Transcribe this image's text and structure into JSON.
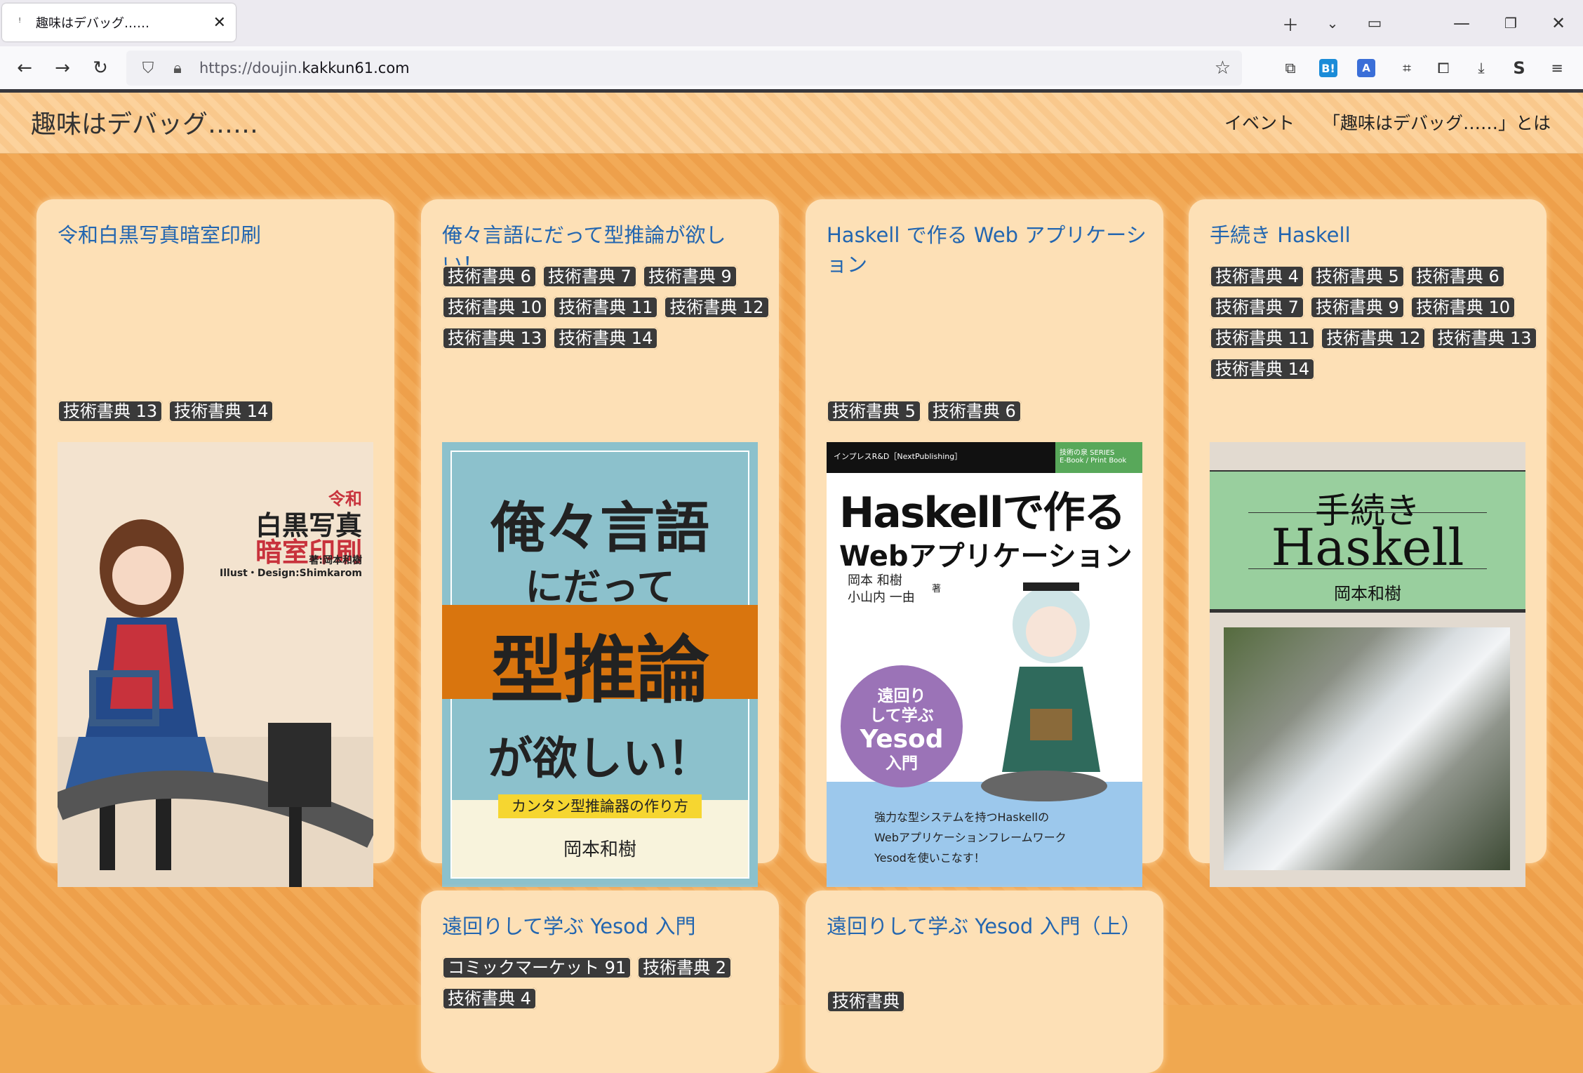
{
  "browser": {
    "tab_title": "趣味はデバッグ……",
    "url_prefix": "https://doujin.",
    "url_domain": "kakkun61.com"
  },
  "site": {
    "title": "趣味はデバッグ……",
    "nav": [
      "イベント",
      "「趣味はデバッグ……」とは"
    ]
  },
  "cards": [
    {
      "title": "令和白黒写真暗室印刷",
      "tags": [
        "技術書典 13",
        "技術書典 14"
      ],
      "cover": {
        "title_line1": "令和",
        "title_line2": "白黒写真",
        "title_line3": "暗室印刷",
        "credit1": "著:岡本和樹",
        "credit2": "Illust・Design:Shimkarom"
      }
    },
    {
      "title": "俺々言語にだって型推論が欲しい！",
      "tags": [
        "技術書典 6",
        "技術書典 7",
        "技術書典 9",
        "技術書典 10",
        "技術書典 11",
        "技術書典 12",
        "技術書典 13",
        "技術書典 14"
      ],
      "cover": {
        "line1": "俺々言語",
        "line2": "にだって",
        "line3": "型推論",
        "line4": "が欲しい！",
        "subtitle": "カンタン型推論器の作り方",
        "author": "岡本和樹"
      }
    },
    {
      "title": "Haskell で作る Web アプリケーション",
      "tags": [
        "技術書典 5",
        "技術書典 6"
      ],
      "cover": {
        "publisher": "インプレスR&D［NextPublishing］",
        "series": "技術の泉 SERIES",
        "format": "E-Book / Print Book",
        "title1": "Haskellで作る",
        "title2": "Webアプリケーション",
        "author1": "岡本 和樹",
        "author2": "小山内 一由",
        "author_suffix": "著",
        "badge1": "遠回り",
        "badge2": "して学ぶ",
        "badge3": "Yesod",
        "badge4": "入門",
        "desc1": "強力な型システムを持つHaskellの",
        "desc2": "Webアプリケーションフレームワーク",
        "desc3": "Yesodを使いこなす！"
      }
    },
    {
      "title": "手続き Haskell",
      "tags": [
        "技術書典 4",
        "技術書典 5",
        "技術書典 6",
        "技術書典 7",
        "技術書典 9",
        "技術書典 10",
        "技術書典 11",
        "技術書典 12",
        "技術書典 13",
        "技術書典 14"
      ],
      "cover": {
        "title1": "手続き",
        "title2": "Haskell",
        "author": "岡本和樹"
      }
    },
    {
      "title": "遠回りして学ぶ Yesod 入門",
      "tags": [
        "コミックマーケット 91",
        "技術書典 2",
        "技術書典 4"
      ]
    },
    {
      "title": "遠回りして学ぶ Yesod 入門（上）",
      "tags": [
        "技術書典"
      ]
    }
  ],
  "colors": {
    "accent_link": "#2366b0",
    "tag_bg": "#3a3a3a",
    "card_bg": "#fde0b6",
    "page_bg": "#f0a850"
  }
}
